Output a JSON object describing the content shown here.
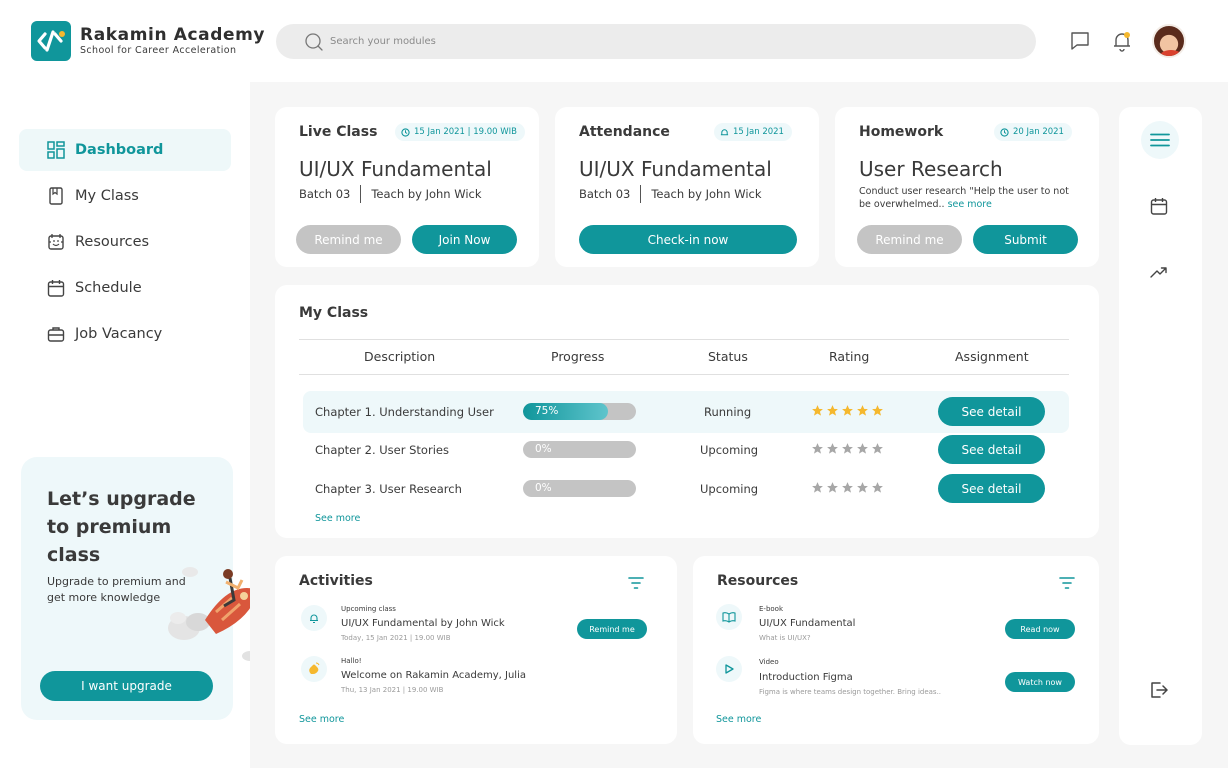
{
  "brand": {
    "name": "Rakamin Academy",
    "tagline": "School for Career Acceleration"
  },
  "search": {
    "placeholder": "Search your modules"
  },
  "header_icons": [
    "message-icon",
    "bell-icon",
    "avatar"
  ],
  "sidebar": {
    "items": [
      {
        "label": "Dashboard",
        "icon": "dashboard-icon",
        "active": true
      },
      {
        "label": "My Class",
        "icon": "book-icon",
        "active": false
      },
      {
        "label": "Resources",
        "icon": "resources-icon",
        "active": false
      },
      {
        "label": "Schedule",
        "icon": "calendar-icon",
        "active": false
      },
      {
        "label": "Job Vacancy",
        "icon": "briefcase-icon",
        "active": false
      }
    ],
    "upgrade": {
      "title": "Let’s upgrade to premium class",
      "description": "Upgrade to premium and get more knowledge",
      "button": "I want upgrade"
    }
  },
  "cards": {
    "live": {
      "label": "Live Class",
      "date": "15 Jan 2021 | 19.00 WIB",
      "title": "UI/UX Fundamental",
      "batch": "Batch 03",
      "teacher": "Teach by John Wick",
      "btn_secondary": "Remind me",
      "btn_primary": "Join Now"
    },
    "attendance": {
      "label": "Attendance",
      "date": "15 Jan 2021",
      "title": "UI/UX Fundamental",
      "batch": "Batch 03",
      "teacher": "Teach by John Wick",
      "btn_primary": "Check-in now"
    },
    "homework": {
      "label": "Homework",
      "date": "20 Jan 2021",
      "title": "User Research",
      "description": "Conduct user research \"Help the user to not be overwhelmed..",
      "see_more": "see more",
      "btn_secondary": "Remind me",
      "btn_primary": "Submit"
    }
  },
  "my_class": {
    "title": "My Class",
    "columns": [
      "Description",
      "Progress",
      "Status",
      "Rating",
      "Assignment"
    ],
    "rows": [
      {
        "description": "Chapter 1. Understanding User",
        "progress": 75,
        "progress_label": "75%",
        "status": "Running",
        "rating": 5,
        "action": "See detail"
      },
      {
        "description": "Chapter 2. User Stories",
        "progress": 0,
        "progress_label": "0%",
        "status": "Upcoming",
        "rating": 0,
        "action": "See detail"
      },
      {
        "description": "Chapter 3. User Research",
        "progress": 0,
        "progress_label": "0%",
        "status": "Upcoming",
        "rating": 0,
        "action": "See detail"
      }
    ],
    "see_more": "See more"
  },
  "activities": {
    "title": "Activities",
    "items": [
      {
        "icon": "bell-icon",
        "kind": "Upcoming class",
        "text": "UI/UX Fundamental by John Wick",
        "time": "Today, 15 Jan 2021 | 19.00 WIB",
        "action": "Remind me"
      },
      {
        "icon": "wave-hand-icon",
        "kind": "Hallo!",
        "text": "Welcome on Rakamin Academy, Julia",
        "time": "Thu, 13 Jan 2021 | 19.00 WIB",
        "action": ""
      }
    ],
    "see_more": "See more"
  },
  "resources": {
    "title": "Resources",
    "items": [
      {
        "icon": "book-open-icon",
        "kind": "E-book",
        "text": "UI/UX Fundamental",
        "sub": "What is UI/UX?",
        "action": "Read now"
      },
      {
        "icon": "play-icon",
        "kind": "Video",
        "text": "Introduction Figma",
        "sub": "Figma is where teams design together. Bring ideas..",
        "action": "Watch now"
      }
    ],
    "see_more": "See more"
  },
  "colors": {
    "accent": "#10969b",
    "accent_light": "#eef8fa",
    "muted": "#c4c4c4",
    "star": "#f5b82e",
    "star_off": "#a7a7a7"
  }
}
